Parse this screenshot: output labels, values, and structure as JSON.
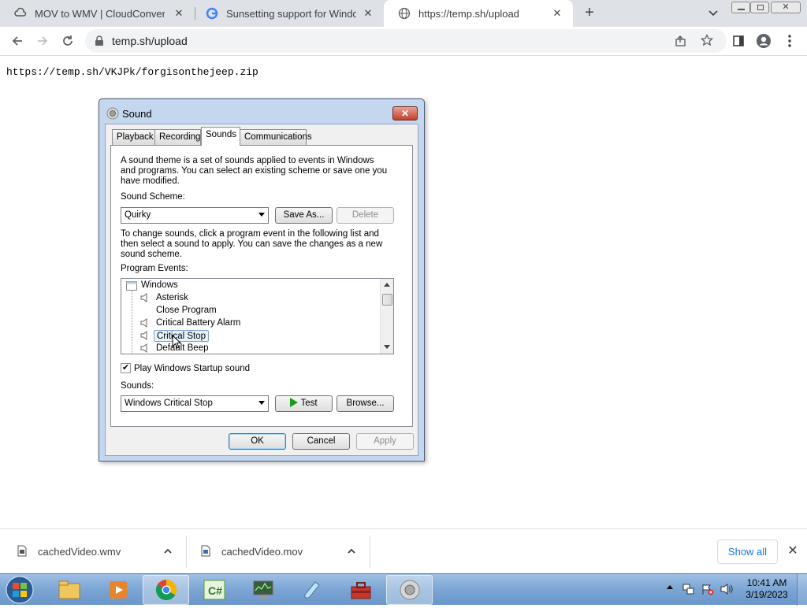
{
  "browser": {
    "tabs": [
      {
        "title": "MOV to WMV | CloudConvert",
        "icon": "cloudconvert-icon"
      },
      {
        "title": "Sunsetting support for Windows",
        "icon": "google-icon"
      },
      {
        "title": "https://temp.sh/upload",
        "icon": "globe-icon",
        "active": true
      }
    ],
    "address": "temp.sh/upload"
  },
  "page": {
    "content_url": "https://temp.sh/VKJPk/forgisonthejeep.zip"
  },
  "dialog": {
    "title": "Sound",
    "tabs": [
      "Playback",
      "Recording",
      "Sounds",
      "Communications"
    ],
    "active_tab": "Sounds",
    "intro_text": [
      "A sound theme is a set of sounds applied to events in Windows",
      "and programs.  You can select an existing scheme or save one you",
      "have modified."
    ],
    "scheme_label": "Sound Scheme:",
    "scheme_value": "Quirky",
    "save_as_label": "Save As...",
    "delete_label": "Delete",
    "change_text": [
      "To change sounds, click a program event in the following list and",
      "then select a sound to apply.  You can save the changes as a new",
      "sound scheme."
    ],
    "events_label": "Program Events:",
    "events": [
      {
        "label": "Windows",
        "type": "group"
      },
      {
        "label": "Asterisk",
        "has_sound": true
      },
      {
        "label": "Close Program",
        "has_sound": false
      },
      {
        "label": "Critical Battery Alarm",
        "has_sound": true
      },
      {
        "label": "Critical Stop",
        "has_sound": true,
        "selected": true
      },
      {
        "label": "Default Beep",
        "has_sound": true
      }
    ],
    "startup_checkbox_label": "Play Windows Startup sound",
    "startup_checked": true,
    "sounds_label": "Sounds:",
    "sound_value": "Windows Critical Stop",
    "test_label": "Test",
    "browse_label": "Browse...",
    "ok_label": "OK",
    "cancel_label": "Cancel",
    "apply_label": "Apply"
  },
  "downloads": {
    "items": [
      {
        "name": "cachedVideo.wmv"
      },
      {
        "name": "cachedVideo.mov"
      }
    ],
    "show_all_label": "Show all"
  },
  "taskbar": {
    "time": "10:41 AM",
    "date": "3/19/2023"
  },
  "colors": {
    "accent": "#1a73e8",
    "tabstrip": "#dee1e6",
    "taskbar": "#7aa5d4"
  }
}
